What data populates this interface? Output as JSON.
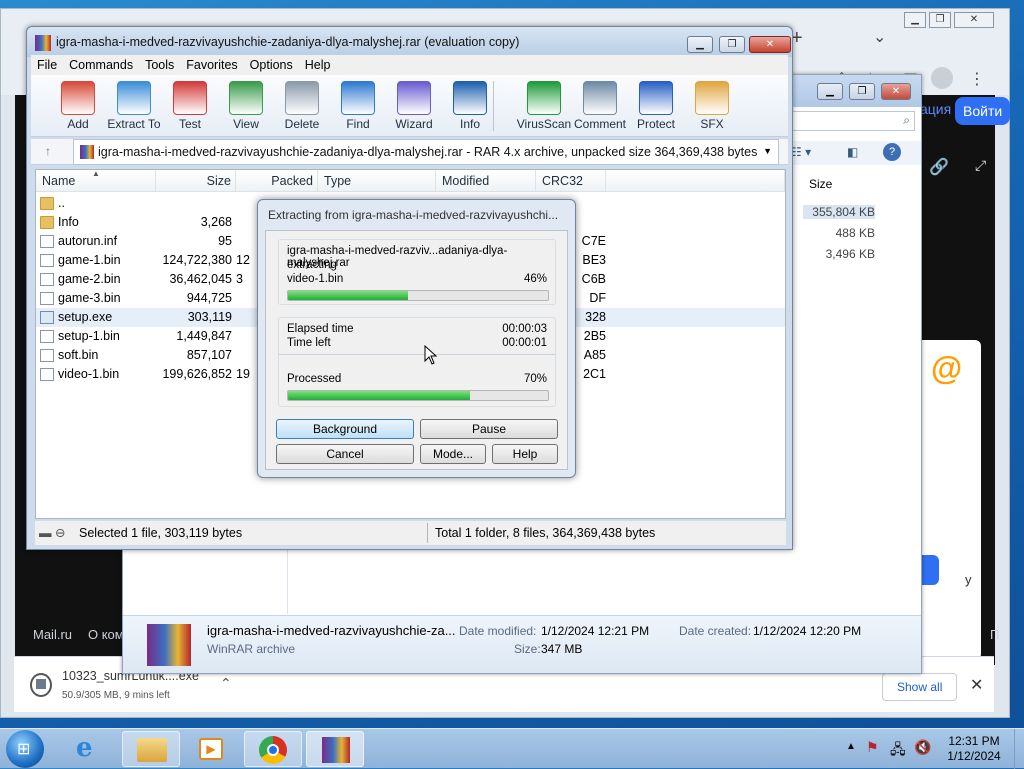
{
  "chrome": {
    "new_tab": "+",
    "chevron": "⌄",
    "login_button": "Войти",
    "partial_text": "ация",
    "footer_mailru": "Mail.ru",
    "footer_partial": "О ком",
    "partial_right_1": "у",
    "partial_right_2": "П"
  },
  "download_bar": {
    "filename": "10323_sumrLuntik....exe",
    "progress": "50.9/305 MB, 9 mins left",
    "progress_fraction": 0.167,
    "show_all": "Show all"
  },
  "explorer": {
    "size_header": "Size",
    "sizes": [
      "355,804 KB",
      "488 KB",
      "3,496 KB"
    ],
    "detail": {
      "name": "igra-masha-i-medved-razvivayushchie-za...",
      "type": "WinRAR archive",
      "modified_label": "Date modified:",
      "modified_value": "1/12/2024 12:21 PM",
      "size_label": "Size:",
      "size_value": "347 MB",
      "created_label": "Date created:",
      "created_value": "1/12/2024 12:20 PM"
    }
  },
  "winrar": {
    "title": "igra-masha-i-medved-razvivayushchie-zadaniya-dlya-malyshej.rar (evaluation copy)",
    "menu": [
      "File",
      "Commands",
      "Tools",
      "Favorites",
      "Options",
      "Help"
    ],
    "toolbar": [
      {
        "label": "Add",
        "icon": "add-archive-icon"
      },
      {
        "label": "Extract To",
        "icon": "extract-folder-icon"
      },
      {
        "label": "Test",
        "icon": "test-checklist-icon"
      },
      {
        "label": "View",
        "icon": "view-book-icon"
      },
      {
        "label": "Delete",
        "icon": "trash-can-icon"
      },
      {
        "label": "Find",
        "icon": "magnifier-icon"
      },
      {
        "label": "Wizard",
        "icon": "magic-wand-icon"
      },
      {
        "label": "Info",
        "icon": "info-icon"
      },
      {
        "label": "VirusScan",
        "icon": "virus-scan-icon"
      },
      {
        "label": "Comment",
        "icon": "comment-icon"
      },
      {
        "label": "Protect",
        "icon": "shield-icon"
      },
      {
        "label": "SFX",
        "icon": "sfx-box-icon"
      }
    ],
    "path": "igra-masha-i-medved-razvivayushchie-zadaniya-dlya-malyshej.rar - RAR 4.x archive, unpacked size 364,369,438 bytes",
    "columns": [
      "Name",
      "Size",
      "Packed",
      "Type",
      "Modified",
      "CRC32"
    ],
    "files": [
      {
        "name": "..",
        "size": "",
        "packed": "",
        "crc": "",
        "kind": "folder"
      },
      {
        "name": "Info",
        "size": "3,268",
        "packed": "",
        "crc": "",
        "kind": "folder"
      },
      {
        "name": "autorun.inf",
        "size": "95",
        "packed": "",
        "crc": "C7E",
        "kind": "doc"
      },
      {
        "name": "game-1.bin",
        "size": "124,722,380",
        "packed": "12",
        "crc": "BE3",
        "kind": "doc"
      },
      {
        "name": "game-2.bin",
        "size": "36,462,045",
        "packed": "3",
        "crc": "C6B",
        "kind": "doc"
      },
      {
        "name": "game-3.bin",
        "size": "944,725",
        "packed": "",
        "crc": "DF",
        "kind": "doc"
      },
      {
        "name": "setup.exe",
        "size": "303,119",
        "packed": "",
        "crc": "328",
        "kind": "exe"
      },
      {
        "name": "setup-1.bin",
        "size": "1,449,847",
        "packed": "",
        "crc": "2B5",
        "kind": "doc"
      },
      {
        "name": "soft.bin",
        "size": "857,107",
        "packed": "",
        "crc": "A85",
        "kind": "doc"
      },
      {
        "name": "video-1.bin",
        "size": "199,626,852",
        "packed": "19",
        "crc": "2C1",
        "kind": "doc"
      }
    ],
    "status_left": "Selected 1 file, 303,119 bytes",
    "status_right": "Total 1 folder, 8 files, 364,369,438 bytes"
  },
  "extract_dialog": {
    "title": "Extracting from igra-masha-i-medved-razvivayushchi...",
    "archive": "igra-masha-i-medved-razviv...adaniya-dlya-malyshej.rar",
    "action": "extracting",
    "current_file": "video-1.bin",
    "file_percent": "46%",
    "file_fraction": 0.46,
    "elapsed_label": "Elapsed time",
    "elapsed_value": "00:00:03",
    "left_label": "Time left",
    "left_value": "00:00:01",
    "processed_label": "Processed",
    "processed_percent": "70%",
    "processed_fraction": 0.7,
    "buttons": {
      "background": "Background",
      "pause": "Pause",
      "cancel": "Cancel",
      "mode": "Mode...",
      "help": "Help"
    }
  },
  "taskbar": {
    "time": "12:31 PM",
    "date": "1/12/2024"
  }
}
